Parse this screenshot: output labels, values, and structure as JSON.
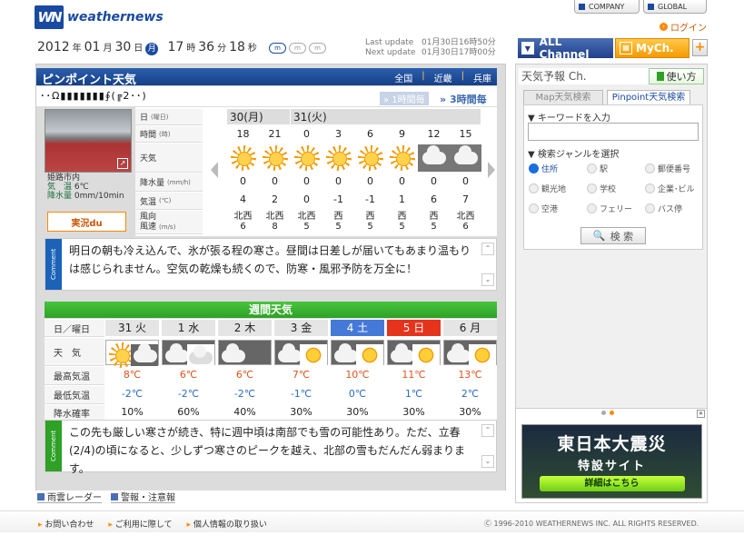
{
  "brand": {
    "logo_mark": "WN",
    "logo_text": "weathernews"
  },
  "top": {
    "company": "COMPANY",
    "global": "GLOBAL",
    "login": "ログイン"
  },
  "date": {
    "year": "2012",
    "y_unit": "年",
    "month": "01",
    "m_unit": "月",
    "day": "30",
    "d_unit": "日",
    "weekday": "月",
    "hour": "17",
    "h_unit": "時",
    "minute": "36",
    "min_unit": "分",
    "second": "18",
    "s_unit": "秒"
  },
  "font_sizes": [
    "m",
    "m",
    "m"
  ],
  "lastupdate": {
    "label1": "Last update",
    "value1": "01月30日16時50分",
    "label2": "Next update",
    "value2": "01月30日17時00分"
  },
  "channels": {
    "all": "ALL Channel",
    "my": "MyCh.",
    "plus": "+"
  },
  "pinpoint": {
    "title": "ピンポイント天気",
    "crumbs": [
      "全国",
      "近畿",
      "兵庫"
    ],
    "location": "･･Ω▮▮▮▮▮▮▮∮(╔2･･)",
    "tab_1h": "1時間毎",
    "tab_3h": "3時間毎"
  },
  "camera": {
    "place": "姫路市内",
    "temp_label": "気　温",
    "temp": "6℃",
    "rain_label": "降水量",
    "rain": "0mm/10min",
    "jikkyou": "実況du"
  },
  "row_labels": {
    "day": "日",
    "day_u": "(曜日)",
    "time": "時間",
    "time_u": "(時)",
    "weather": "天気",
    "rain": "降水量",
    "rain_u": "(mm/h)",
    "temp": "気温",
    "temp_u": "(℃)",
    "wind": "風向",
    "wind2": "風速",
    "wind_u": "(m/s)"
  },
  "days": [
    "30(月)",
    "31(火)"
  ],
  "hourly": [
    {
      "hour": "18",
      "icon": "sun-icon",
      "rain": "0",
      "temp": "4",
      "dir": "北西",
      "speed": "6"
    },
    {
      "hour": "21",
      "icon": "sun-icon",
      "rain": "0",
      "temp": "2",
      "dir": "北西",
      "speed": "8"
    },
    {
      "hour": "0",
      "icon": "sun-icon",
      "rain": "0",
      "temp": "0",
      "dir": "北西",
      "speed": "5"
    },
    {
      "hour": "3",
      "icon": "sun-icon",
      "rain": "0",
      "temp": "-1",
      "dir": "西",
      "speed": "5"
    },
    {
      "hour": "6",
      "icon": "sun-icon",
      "rain": "0",
      "temp": "-1",
      "dir": "西",
      "speed": "5"
    },
    {
      "hour": "9",
      "icon": "sun-icon",
      "rain": "0",
      "temp": "1",
      "dir": "西",
      "speed": "5"
    },
    {
      "hour": "12",
      "icon": "cloud-icon",
      "rain": "0",
      "temp": "6",
      "dir": "西",
      "speed": "5"
    },
    {
      "hour": "15",
      "icon": "cloud-icon",
      "rain": "0",
      "temp": "7",
      "dir": "北西",
      "speed": "6"
    }
  ],
  "comment1": "明日の朝も冷え込んで、氷が張る程の寒さ。昼間は日差しが届いてもあまり温もりは感じられません。空気の乾燥も続くので、防寒・風邪予防を万全に！",
  "comment_label": "Comment",
  "weekly": {
    "title": "週間天気",
    "labels": {
      "day": "日／曜日",
      "weather": "天　気",
      "hi": "最高気温",
      "lo": "最低気温",
      "pop": "降水確率"
    },
    "days": [
      {
        "d": "31",
        "w": "火",
        "hi": "8℃",
        "lo": "-2℃",
        "pop": "10%",
        "kind": "normal"
      },
      {
        "d": "1",
        "w": "水",
        "hi": "6℃",
        "lo": "-2℃",
        "pop": "60%",
        "kind": "normal"
      },
      {
        "d": "2",
        "w": "木",
        "hi": "6℃",
        "lo": "-2℃",
        "pop": "40%",
        "kind": "normal"
      },
      {
        "d": "3",
        "w": "金",
        "hi": "7℃",
        "lo": "-1℃",
        "pop": "30%",
        "kind": "normal"
      },
      {
        "d": "4",
        "w": "土",
        "hi": "10℃",
        "lo": "0℃",
        "pop": "30%",
        "kind": "sat"
      },
      {
        "d": "5",
        "w": "日",
        "hi": "11℃",
        "lo": "1℃",
        "pop": "30%",
        "kind": "sun"
      },
      {
        "d": "6",
        "w": "月",
        "hi": "13℃",
        "lo": "2℃",
        "pop": "30%",
        "kind": "normal"
      }
    ]
  },
  "comment2": "この先も厳しい寒さが続き、特に週中頃は南部でも雪の可能性あり。ただ、立春(2/4)の頃になると、少しずつ寒さのピークを越え、北部の雪もだんだん弱まります。",
  "bottom_links": [
    "雨雲レーダー",
    "警報・注意報"
  ],
  "right": {
    "header": "天気予報 Ch.",
    "howto": "使い方",
    "tab_map": "Map天気検索",
    "tab_pin": "Pinpoint天気検索",
    "kw_label": "▼ キーワードを入力",
    "genre_label": "▼ 検索ジャンルを選択",
    "genres": [
      "住所",
      "駅",
      "郵便番号",
      "観光地",
      "学校",
      "企業･ビル",
      "空港",
      "フェリー",
      "バス停"
    ],
    "search": "検 索"
  },
  "banner": {
    "line1": "東日本大震災",
    "line2": "特設サイト",
    "line3": "詳細はこちら"
  },
  "footer": {
    "links": [
      "お問い合わせ",
      "ご利用に際して",
      "個人情報の取り扱い"
    ],
    "copyright": "Ⓒ 1996-2010 WEATHERNEWS INC. ALL RIGHTS RESERVED."
  }
}
